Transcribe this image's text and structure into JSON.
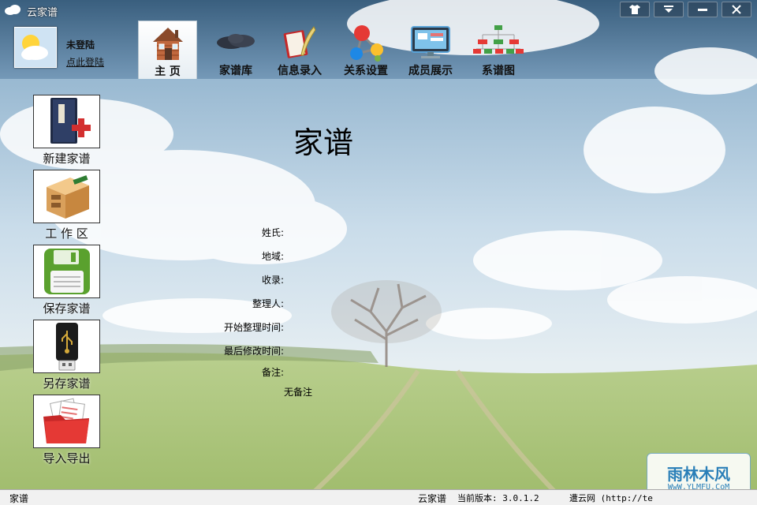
{
  "window": {
    "title": "云家谱"
  },
  "user": {
    "status": "未登陆",
    "login_link": "点此登陆"
  },
  "toolbar": {
    "items": [
      {
        "label": "主 页",
        "icon": "house-icon",
        "active": true
      },
      {
        "label": "家谱库",
        "icon": "cloud-icon"
      },
      {
        "label": "信息录入",
        "icon": "book-quill-icon"
      },
      {
        "label": "关系设置",
        "icon": "molecule-icon"
      },
      {
        "label": "成员展示",
        "icon": "monitor-icon"
      },
      {
        "label": "系谱图",
        "icon": "tree-chart-icon"
      }
    ]
  },
  "sidebar": {
    "items": [
      {
        "label": "新建家谱",
        "icon": "new-book-icon"
      },
      {
        "label": "工 作 区",
        "icon": "desk-icon"
      },
      {
        "label": "保存家谱",
        "icon": "floppy-save-icon"
      },
      {
        "label": "另存家谱",
        "icon": "usb-drive-icon"
      },
      {
        "label": "导入导出",
        "icon": "folder-icon"
      }
    ]
  },
  "main": {
    "title": "家谱",
    "fields": [
      {
        "label": "姓氏:",
        "value": ""
      },
      {
        "label": "地域:",
        "value": ""
      },
      {
        "label": "收录:",
        "value": ""
      },
      {
        "label": "整理人:",
        "value": ""
      },
      {
        "label": "开始整理时间:",
        "value": ""
      },
      {
        "label": "最后修改时间:",
        "value": ""
      },
      {
        "label": "备注:",
        "value": ""
      }
    ],
    "remark_value": "无备注"
  },
  "statusbar": {
    "left": "家谱",
    "app": "云家谱",
    "version": "当前版本: 3.0.1.2",
    "site": "遭云网 (http://te"
  },
  "watermark": {
    "main": "雨林木风",
    "sub": "WwW.YLMFU.CoM"
  },
  "colors": {
    "accent": "#2a7fb8",
    "statusbar": "#f1f1f1"
  }
}
